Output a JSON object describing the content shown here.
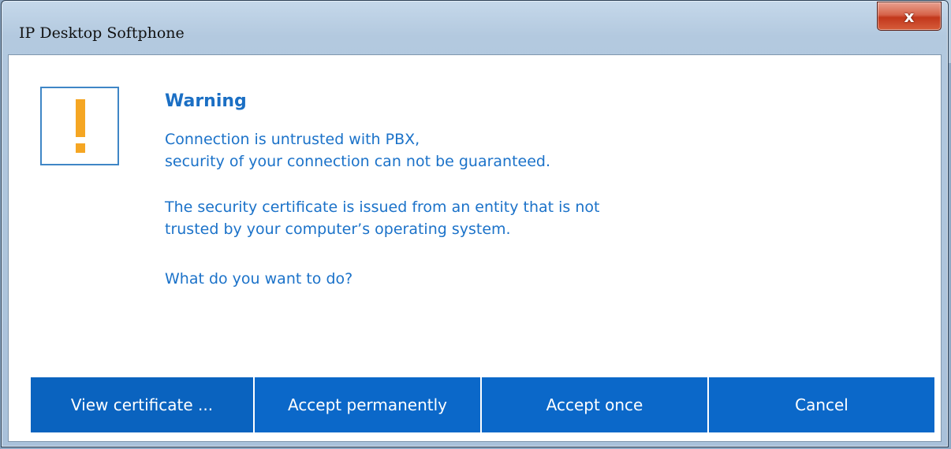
{
  "window": {
    "title": "IP Desktop Softphone",
    "close_symbol": "x"
  },
  "dialog": {
    "icon": "warning-exclamation-icon",
    "heading": "Warning",
    "messages": [
      "Connection is untrusted with PBX,\nsecurity of your connection can not be guaranteed.",
      "The security certificate is issued from an entity that is not\ntrusted by your computer’s operating system.",
      "What do you want to do?"
    ]
  },
  "buttons": {
    "view_certificate": "View certificate ...",
    "accept_permanently": "Accept permanently",
    "accept_once": "Accept once",
    "cancel": "Cancel"
  },
  "colors": {
    "accent": "#0b68c9",
    "text_blue": "#1b72c9",
    "warning": "#f5a623"
  }
}
